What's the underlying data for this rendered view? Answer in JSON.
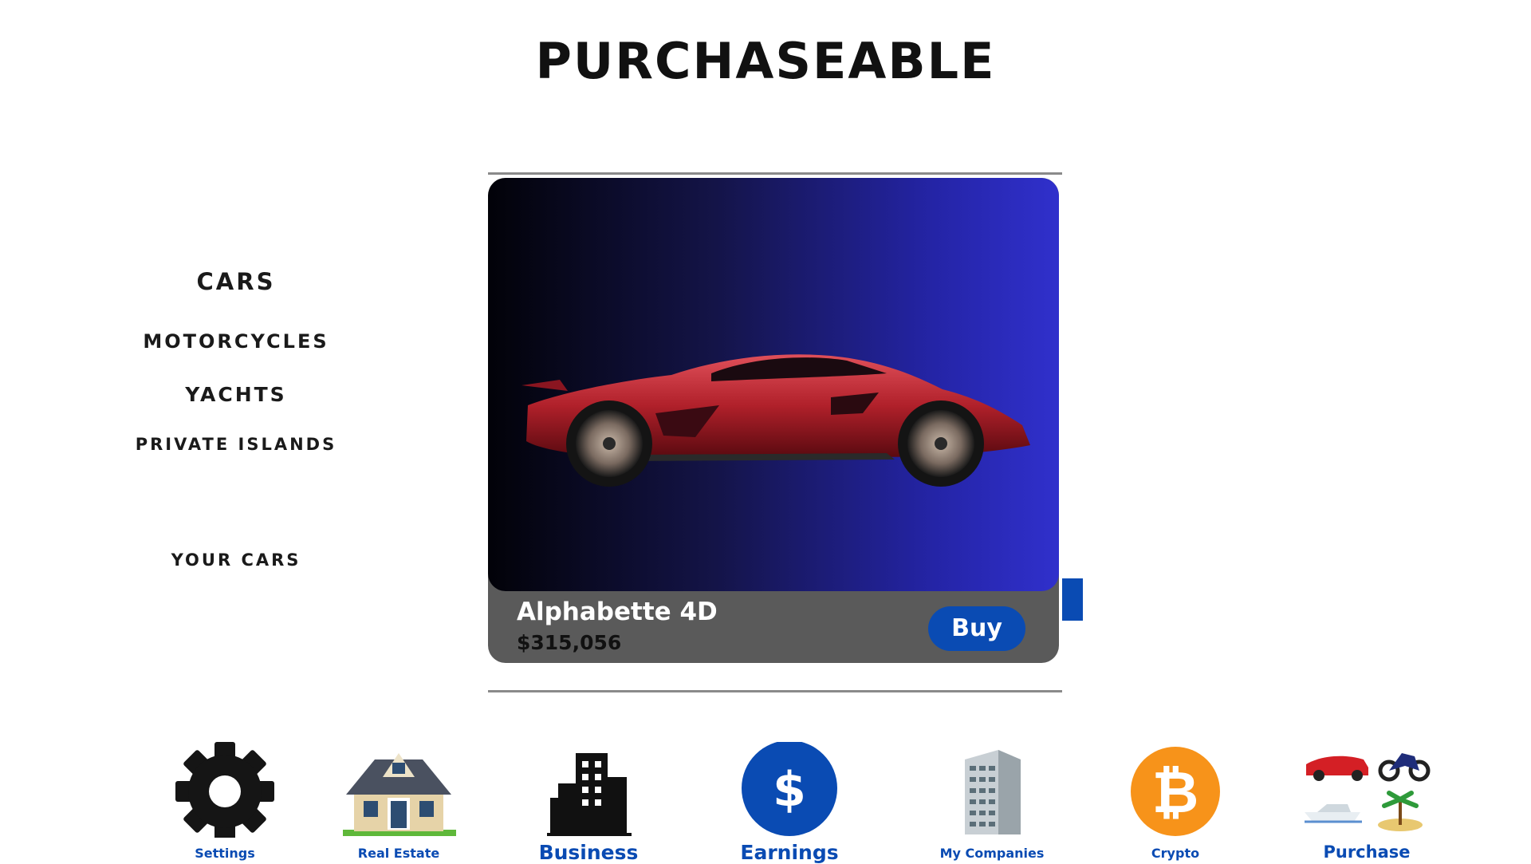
{
  "page": {
    "title": "PURCHASEABLE"
  },
  "categories": {
    "cars": "CARS",
    "motorcycles": "MOTORCYCLES",
    "yachts": "YACHTS",
    "private_islands": "PRIVATE ISLANDS",
    "your_cars": "YOUR CARS"
  },
  "listing": {
    "name": "Alphabette 4D",
    "price": "$315,056",
    "buy_label": "Buy",
    "image_icon": "red-sports-car"
  },
  "nav": {
    "settings": "Settings",
    "real_estate": "Real Estate",
    "business": "Business",
    "earnings": "Earnings",
    "my_companies": "My Companies",
    "crypto": "Crypto",
    "purchase": "Purchase"
  },
  "colors": {
    "accent": "#0a4bb3",
    "card_footer": "#5a5a5a",
    "gradient_start": "#020208",
    "gradient_end": "#3030cc",
    "earnings_circle": "#0a4bb3",
    "crypto_circle": "#f7931a"
  }
}
